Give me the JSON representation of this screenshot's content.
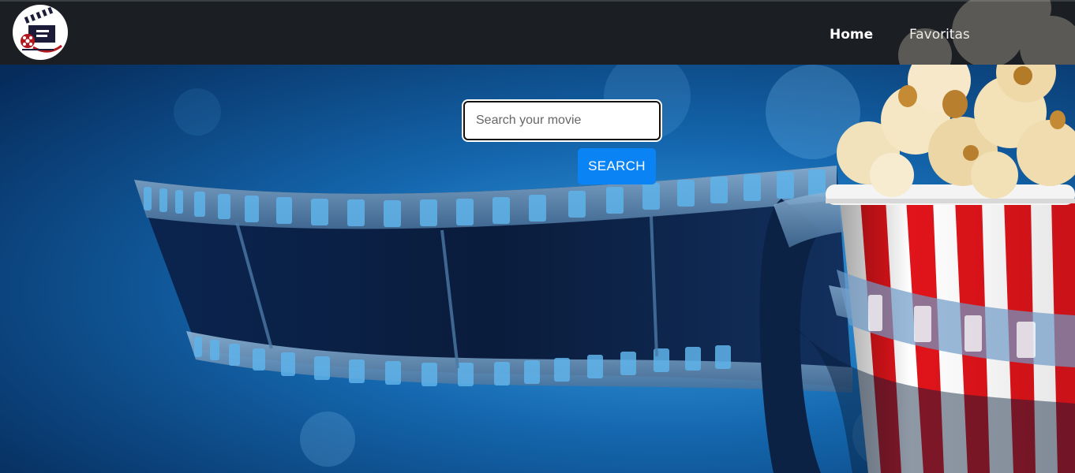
{
  "nav": {
    "logo_icon": "film-clapperboard-reel-icon",
    "links": [
      {
        "label": "Home",
        "active": true
      },
      {
        "label": "Favoritas",
        "active": false
      }
    ]
  },
  "search": {
    "placeholder": "Search your movie",
    "value": "",
    "button_label": "SEARCH"
  },
  "hero": {
    "background": "film-strip-and-popcorn-bucket",
    "colors": {
      "navbar": "#1b1f23",
      "accent": "#0a84f5",
      "bg_deep": "#062c5c",
      "bg_light": "#3aa2e6",
      "popcorn_red": "#e0141a"
    }
  }
}
